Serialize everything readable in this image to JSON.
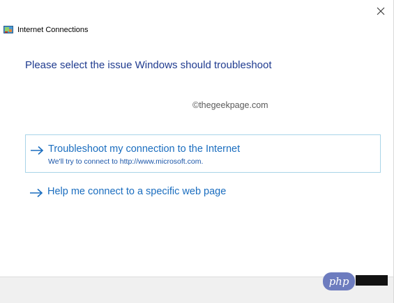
{
  "window": {
    "title": "Internet Connections",
    "app_icon": "network-troubleshooter-icon",
    "close_icon": "close-icon"
  },
  "main": {
    "heading": "Please select the issue Windows should troubleshoot",
    "watermark": "©thegeekpage.com",
    "options": [
      {
        "title": "Troubleshoot my connection to the Internet",
        "description": "We'll try to connect to http://www.microsoft.com.",
        "icon": "arrow-right-icon",
        "selected": true
      },
      {
        "title": "Help me connect to a specific web page",
        "icon": "arrow-right-icon",
        "selected": false
      }
    ]
  },
  "overlay": {
    "badge_text": "php"
  },
  "colors": {
    "heading": "#1f3b8f",
    "link": "#1a6dbf",
    "selection_border": "#a8d4e8",
    "footer_bg": "#f0f0f0",
    "badge_bg": "#6d7cbf"
  }
}
